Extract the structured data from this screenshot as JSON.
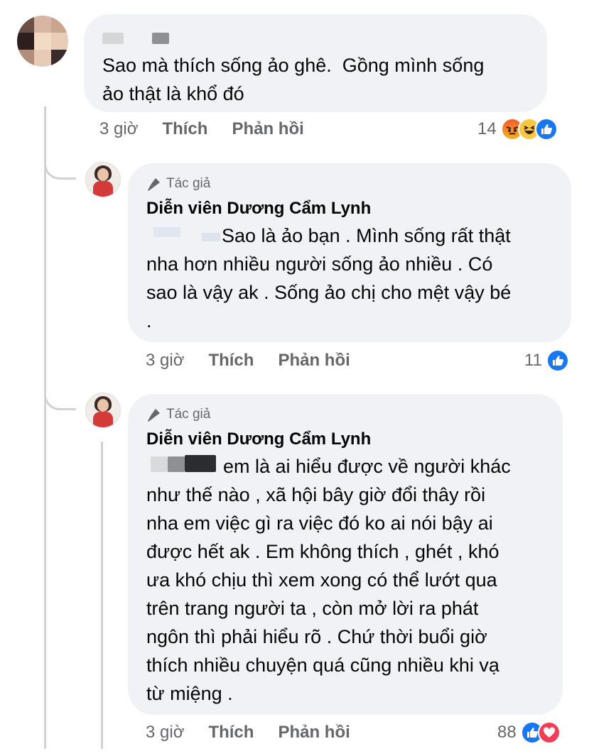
{
  "comment1": {
    "text": "Sao mà thích sống ảo ghê.  Gồng mình sống\nảo thật là khổ đó",
    "time": "3 giờ",
    "like_label": "Thích",
    "reply_label": "Phản hồi",
    "reaction_count": "14",
    "reactions": [
      "angry-icon",
      "haha-icon",
      "like-icon"
    ]
  },
  "reply1": {
    "badge": "Tác giả",
    "author": "Diễn viên Dương Cẩm Lynh",
    "text": "Sao là ảo bạn . Mình sống rất thật\nnha hơn nhiều người sống ảo nhiều . Có\nsao là vậy ak . Sống ảo chị cho mệt vậy bé\n.",
    "time": "3 giờ",
    "like_label": "Thích",
    "reply_label": "Phản hồi",
    "reaction_count": "11",
    "reactions": [
      "like-icon"
    ]
  },
  "reply2": {
    "badge": "Tác giả",
    "author": "Diễn viên Dương Cẩm Lynh",
    "text": "em là ai hiểu được về người khác\nnhư thế nào , xã hội bây giờ đổi thây rồi\nnha em việc gì ra việc đó ko ai nói bậy ai\nđược hết ak . Em không thích , ghét , khó\nưa khó chịu thì xem xong có thể lướt qua\ntrên trang người ta , còn mở lời ra phát\nngôn thì phải hiểu rõ . Chứ thời buổi giờ\nthích nhiều chuyện quá cũng nhiều khi vạ\ntừ miệng .",
    "time": "3 giờ",
    "like_label": "Thích",
    "reply_label": "Phản hồi",
    "reaction_count": "88",
    "reactions": [
      "like-icon",
      "love-icon"
    ]
  },
  "colors": {
    "bubble": "#f0f2f5",
    "meta": "#65676b",
    "like_blue": "#1877f2",
    "love_red": "#f33e58"
  }
}
